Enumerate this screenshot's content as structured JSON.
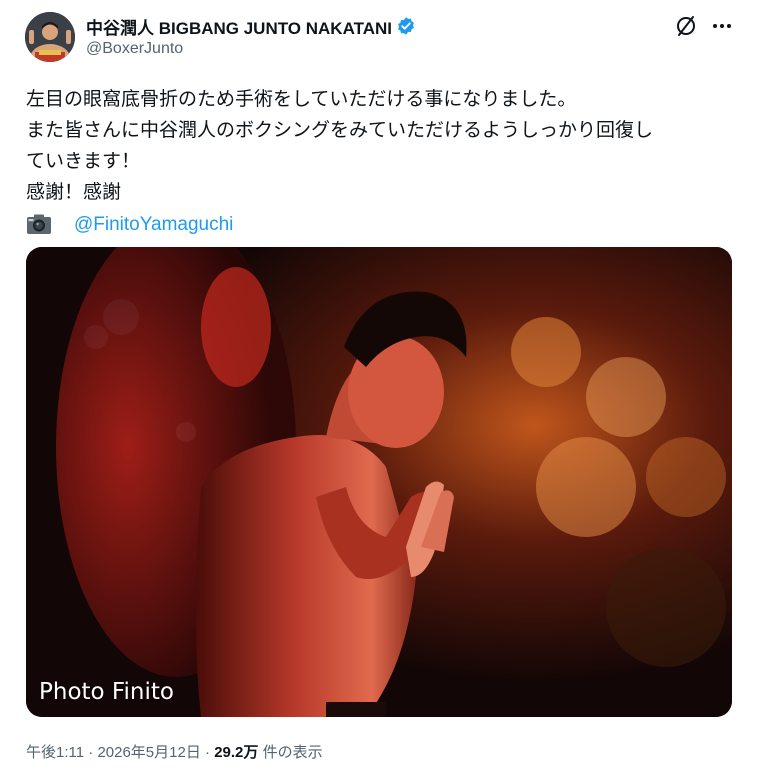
{
  "author": {
    "display_name": "中谷潤人 BIGBANG JUNTO NAKATANI",
    "handle": "@BoxerJunto",
    "verified": true,
    "verified_color": "#1d9bf0"
  },
  "actions": {
    "grok_icon": "grok-icon",
    "more_icon": "more-icon"
  },
  "tweet": {
    "line1": "左目の眼窩底骨折のため手術をしていただける事になりました。",
    "line2": "また皆さんに中谷潤人のボクシングをみていただけるようしっかり回復し",
    "line3": "ていきます！",
    "line4": "感謝！感謝",
    "credit_icon": "camera-icon",
    "credit_mention": "@FinitoYamaguchi",
    "mention_color": "#1d9bf0"
  },
  "photo": {
    "watermark": "Photo Finito"
  },
  "meta": {
    "time": "午後1:11",
    "separator": "·",
    "date": "2026年5月12日",
    "views_count": "29.2万",
    "views_label": "件の表示"
  }
}
